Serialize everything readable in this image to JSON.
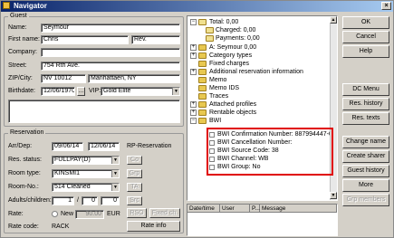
{
  "window": {
    "title": "Navigator",
    "close": "×"
  },
  "guest": {
    "legend": "Guest",
    "name_label": "Name:",
    "name_value": "Seymour",
    "first_label": "First name:",
    "first_value": "Chris",
    "salutation": "Rev.",
    "company_label": "Company:",
    "company_value": "",
    "street_label": "Street:",
    "street_value": "754 Rth Ave.",
    "zip_label": "ZIP/City:",
    "zip_value": "NV 10012",
    "city_value": "Manhattaen, NY",
    "birth_label": "Birthdate:",
    "birth_value": "12/06/1970",
    "birth_btn": "...",
    "vip_label": "VIP:",
    "vip_value": "Gold Elite"
  },
  "reservation": {
    "legend": "Reservation",
    "arrdep_label": "Arr/Dep:",
    "arr_value": "09/06/14",
    "dep_value": "12/06/14",
    "status_label": "Res. status:",
    "status_value": "FULLPAY(D)",
    "roomtype_label": "Room type:",
    "roomtype_value": "KINSMI1",
    "roomno_label": "Room-No.:",
    "roomno_value": "514 Cleaned",
    "adults_label": "Adults/children:",
    "adults_value": "1",
    "slash": "/",
    "children_value": "0",
    "extra_value": "0",
    "rate_label": "Rate:",
    "new_label": "New",
    "rate_value": "90.00",
    "currency": "EUR",
    "ratecode_label": "Rate code:",
    "ratecode_value": "RACK"
  },
  "rp_reservation": {
    "label": "RP-Reservation",
    "btn_co": "Co",
    "btn_grp": "Grp",
    "btn_ta": "TA",
    "btn_src": "Src",
    "btn_rso": "RSO",
    "btn_fixed": "Fixed ch.",
    "btn_rate_info": "Rate info"
  },
  "tree": {
    "total": "Total: 0,00",
    "charged": "Charged: 0,00",
    "payments": "Payments: 0,00",
    "account": "A: Seymour 0,00",
    "category_types": "Category types",
    "fixed_charges": "Fixed charges",
    "additional": "Additional reservation information",
    "memo": "Memo",
    "memo_ids": "Memo IDS",
    "traces": "Traces",
    "attached": "Attached profiles",
    "rentable": "Rentable objects",
    "bwi": "BWI",
    "bwi_items": [
      "BWI Confirmation Number: 887994447-01",
      "BWI Cancellation Number:",
      "BWI Source Code: 38",
      "BWI Channel: WB",
      "BWI Group: No"
    ]
  },
  "log": {
    "col_date": "Date/time",
    "col_user": "User",
    "col_p": "P...",
    "col_message": "Message"
  },
  "right_buttons": {
    "ok": "OK",
    "cancel": "Cancel",
    "help": "Help",
    "dc_menu": "DC Menu",
    "res_history": "Res. history",
    "res_texts": "Res. texts",
    "change_name": "Change name",
    "create_sharer": "Create sharer",
    "guest_history": "Guest history",
    "more": "More",
    "grp_members": "Grp members"
  },
  "colors": {
    "highlight": "#e00000",
    "window": "#d4d0c8",
    "title_start": "#0a246a"
  }
}
